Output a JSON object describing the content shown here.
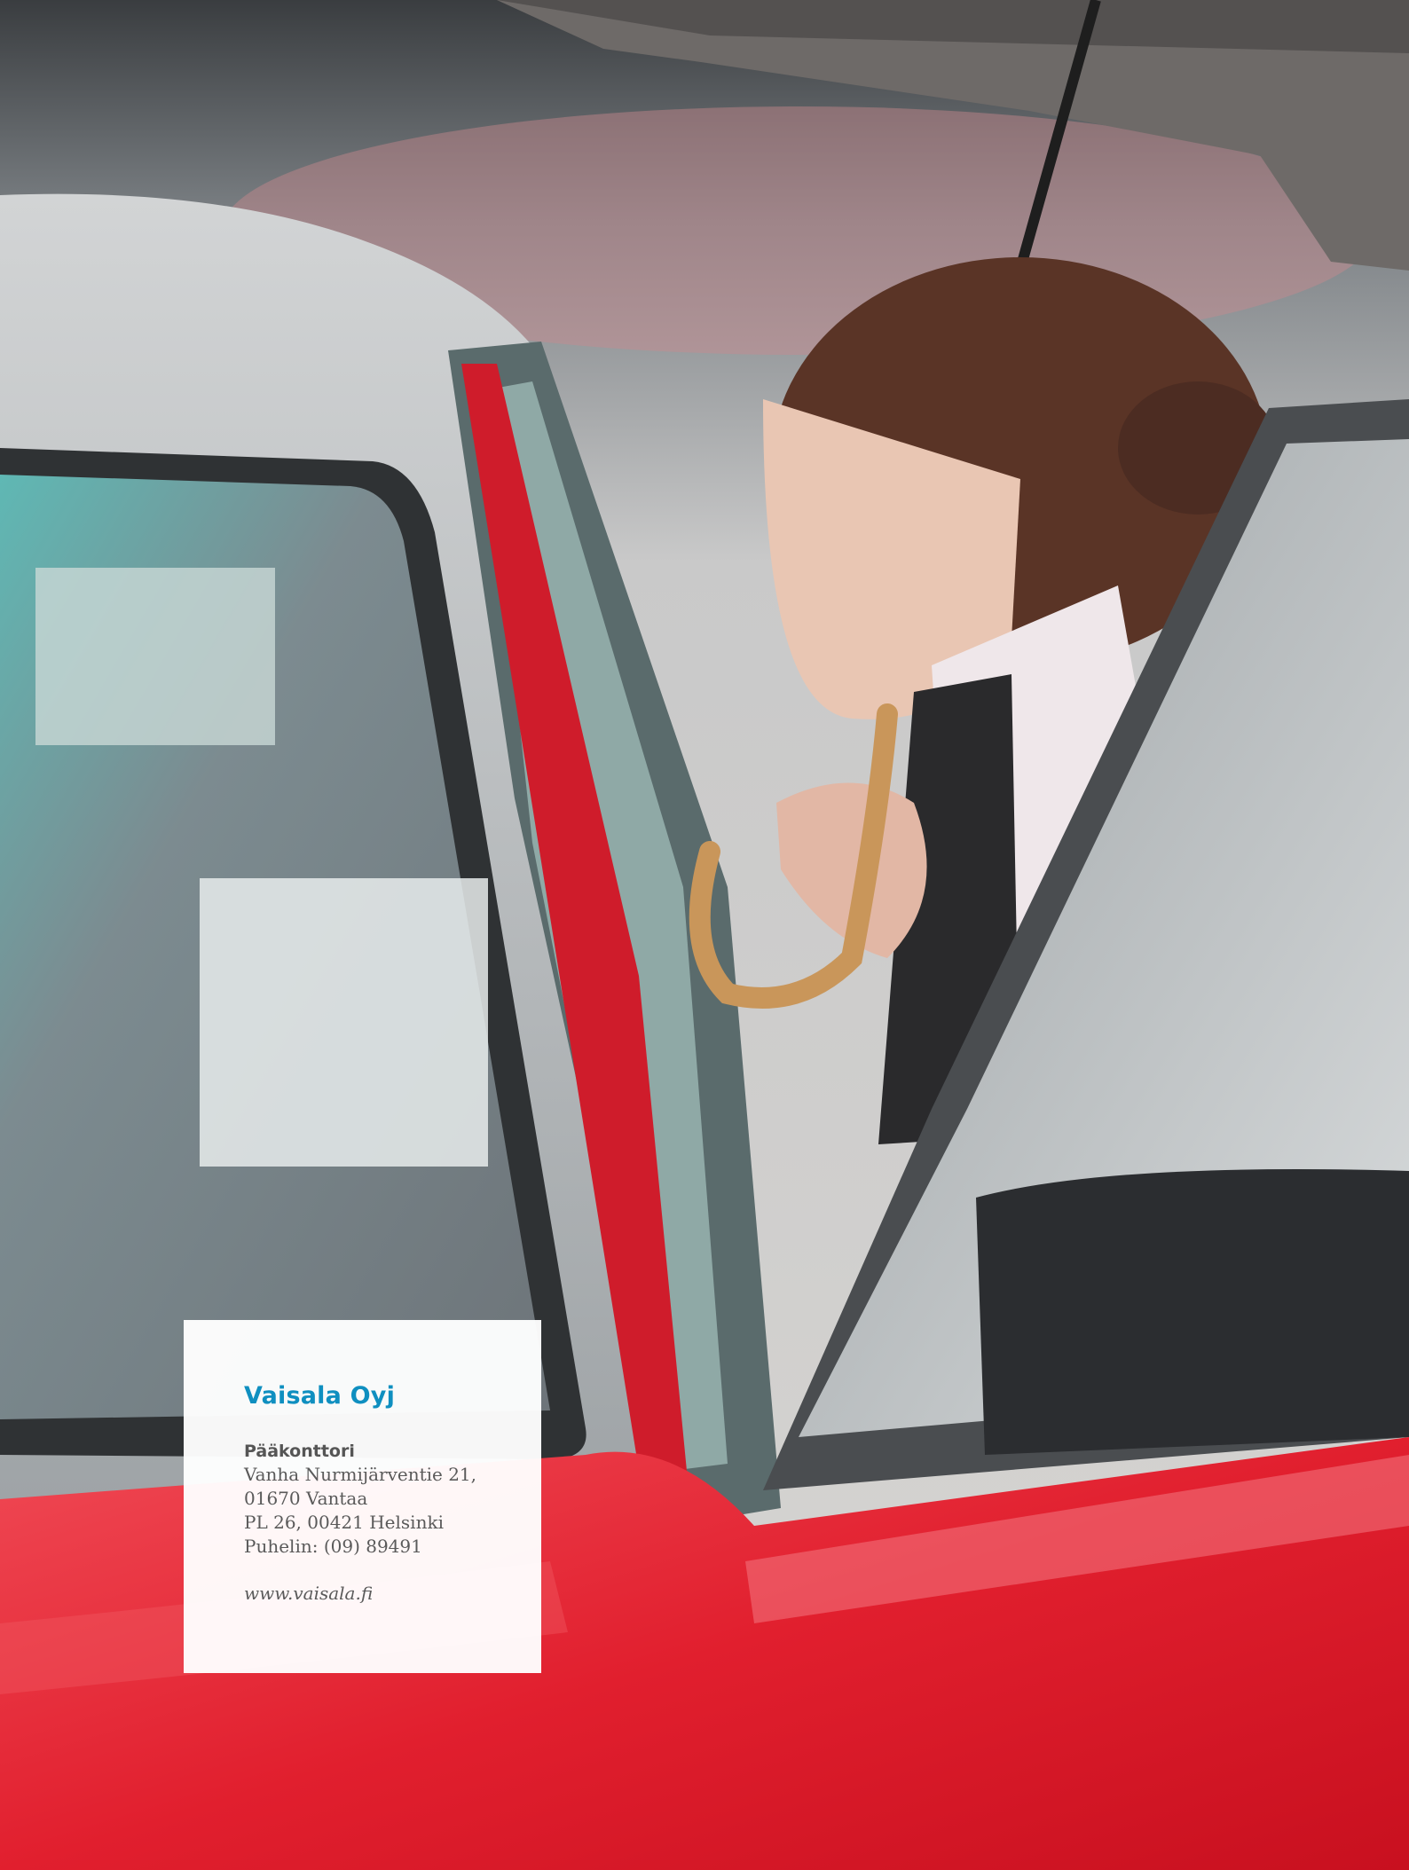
{
  "contact": {
    "company": "Vaisala Oyj",
    "office_heading": "Pääkonttori",
    "address_lines": [
      "Vanha Nurmijärventie 21,",
      "01670 Vantaa",
      "PL 26, 00421 Helsinki",
      "Puhelin: (09) 89491"
    ],
    "website": "www.vaisala.fi"
  },
  "colors": {
    "accent": "#0f8fc0",
    "car_red": "#e11f2e"
  }
}
